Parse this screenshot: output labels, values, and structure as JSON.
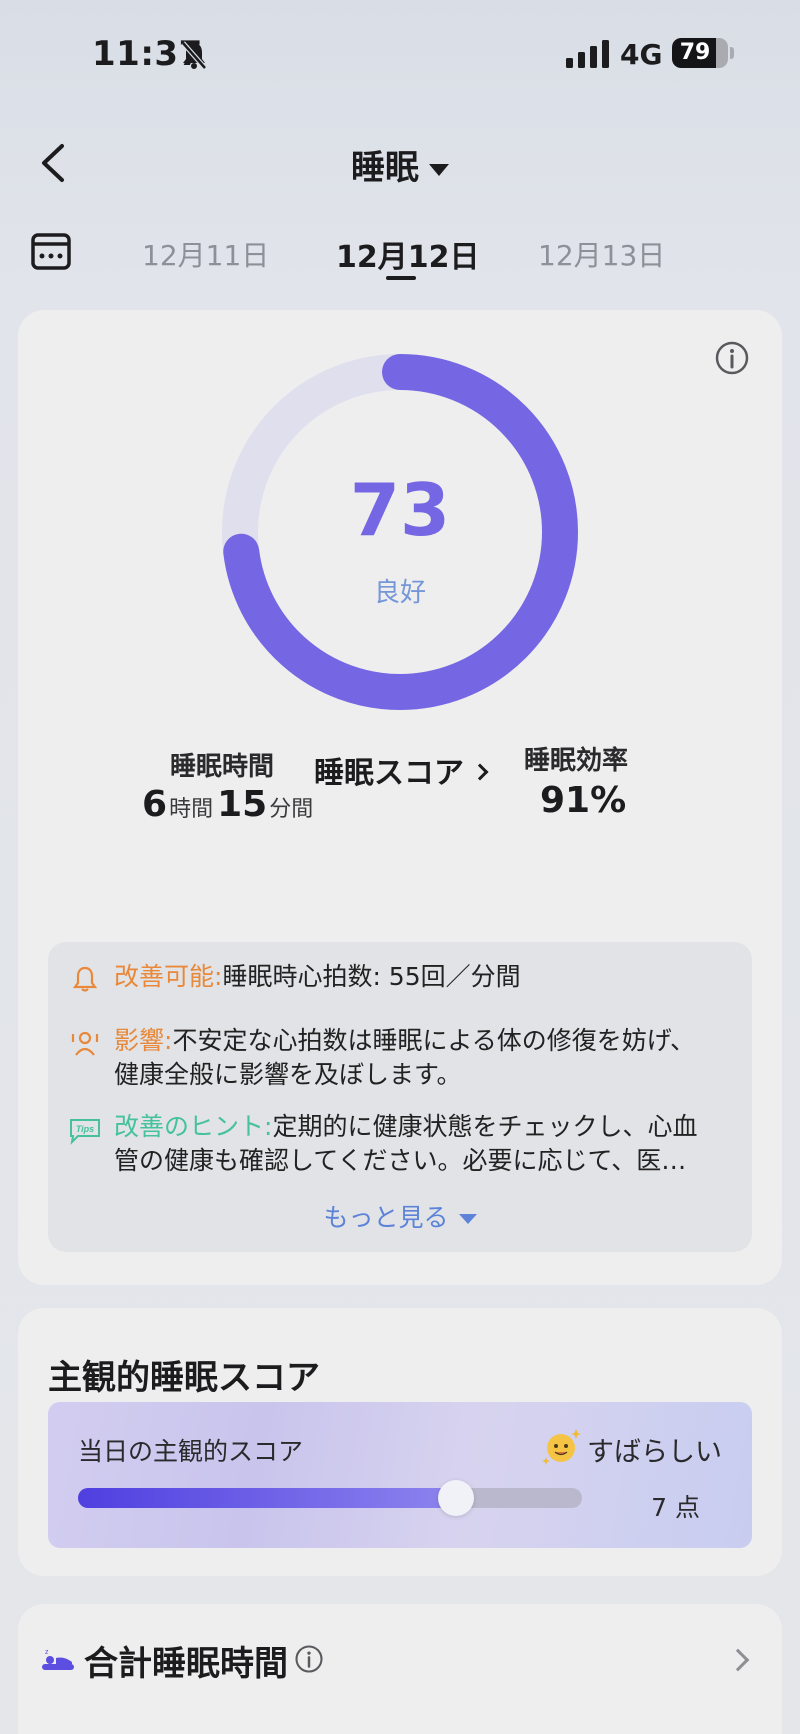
{
  "status_bar": {
    "time": "11:37",
    "network": "4G",
    "battery": "79",
    "battery_level": 0.79,
    "icons": [
      "bell-slash-icon",
      "signal-icon"
    ]
  },
  "header": {
    "title": "睡眠",
    "icons": [
      "back-arrow-icon",
      "caret-down-icon"
    ]
  },
  "date_tabs": {
    "items": [
      "12月11日",
      "12月12日",
      "12月13日"
    ],
    "active_index": 1
  },
  "score": {
    "value": "73",
    "label": "良好",
    "percent": 73,
    "link": "睡眠スコア",
    "colors": {
      "arc": "#7566e3",
      "track": "#e0dfee"
    }
  },
  "metrics": {
    "duration_label": "睡眠時間",
    "duration_hours": "6",
    "hours_unit": "時間",
    "duration_minutes": "15",
    "minutes_unit": "分間",
    "efficiency_label": "睡眠効率",
    "efficiency_value": "91%"
  },
  "advice": {
    "improve_key": "改善可能:",
    "improve_text": "睡眠時心拍数: 55回／分間",
    "impact_key": "影響:",
    "impact_line1": "不安定な心拍数は睡眠による体の修復を妨げ、",
    "impact_line2": "健康全般に影響を及ぼします。",
    "tip_key": "改善のヒント:",
    "tip_line1": "定期的に健康状態をチェックし、心血",
    "tip_line2": "管の健康も確認してください。必要に応じて、医…",
    "tips_badge": "Tips",
    "more": "もっと見る"
  },
  "subjective": {
    "title": "主観的睡眠スコア",
    "label": "当日の主観的スコア",
    "rating": "すばらしい",
    "points": "7 点",
    "level": 0.75
  },
  "total": {
    "title": "合計睡眠時間"
  }
}
